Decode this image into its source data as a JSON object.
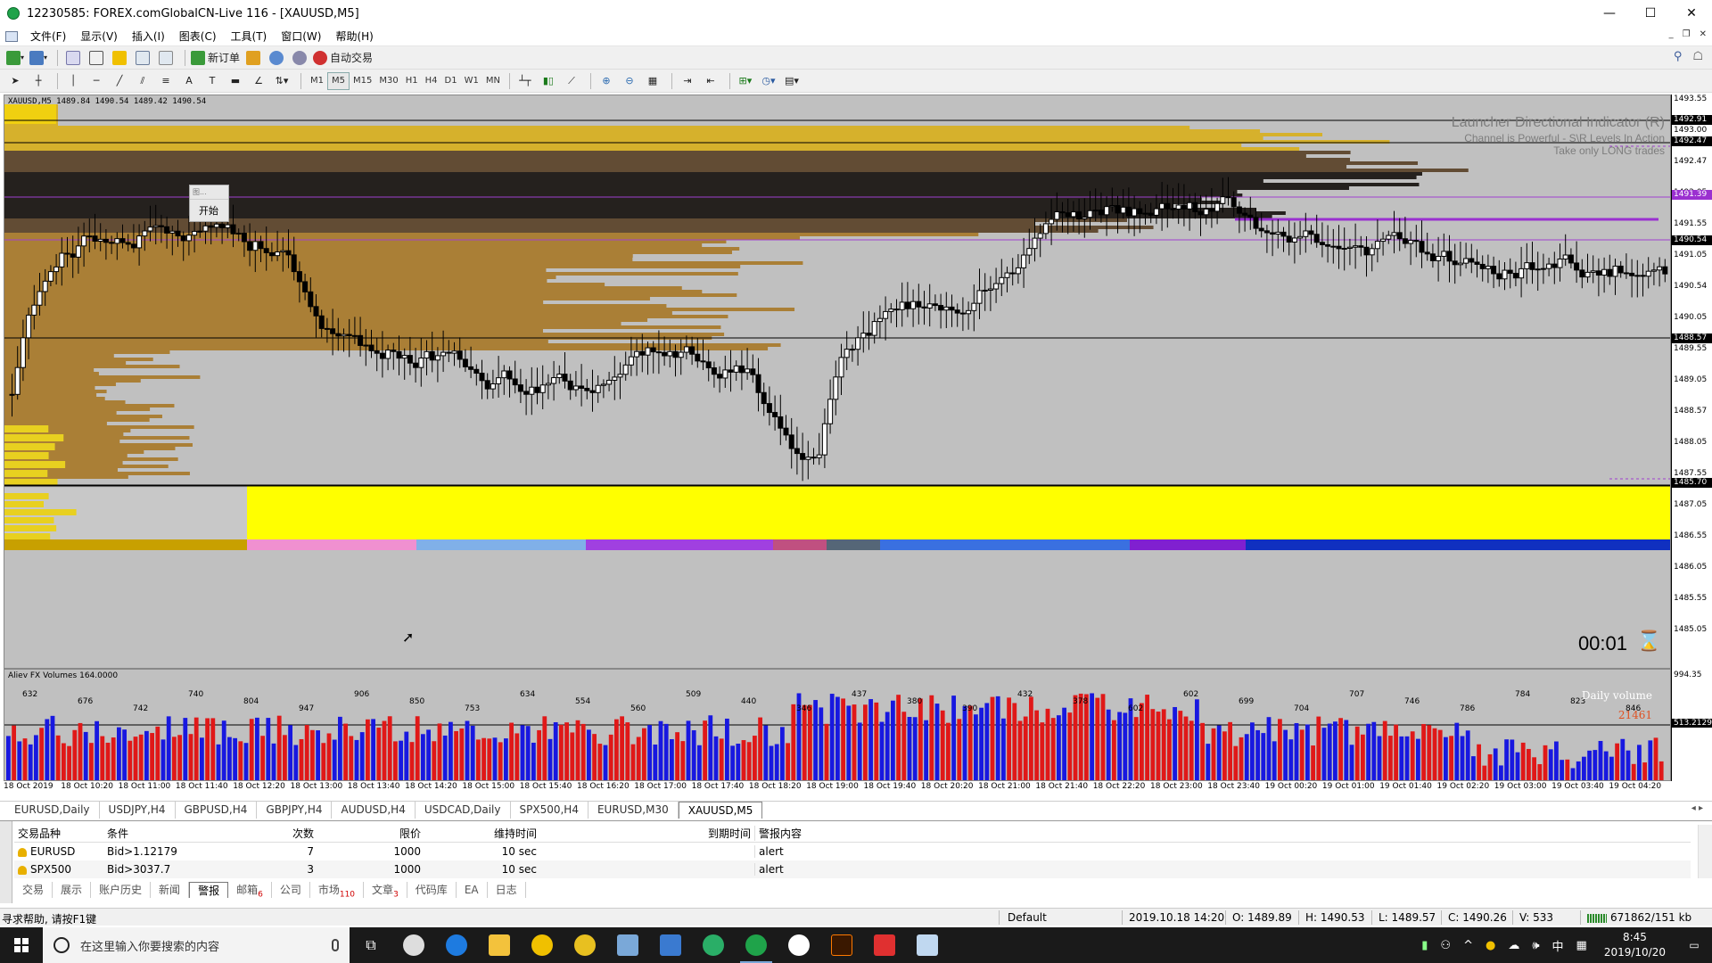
{
  "window": {
    "title": "12230585: FOREX.comGlobalCN-Live 116 - [XAUUSD,M5]",
    "minimize": "—",
    "maximize": "☐",
    "close": "✕"
  },
  "menu": {
    "items": [
      "文件(F)",
      "显示(V)",
      "插入(I)",
      "图表(C)",
      "工具(T)",
      "窗口(W)",
      "帮助(H)"
    ],
    "mdi_controls": [
      "_",
      "❐",
      "✕"
    ]
  },
  "toolbar1": {
    "new_order": "新订单",
    "auto_trading": "自动交易"
  },
  "toolbar2": {
    "timeframes": [
      "M1",
      "M5",
      "M15",
      "M30",
      "H1",
      "H4",
      "D1",
      "W1",
      "MN"
    ],
    "active_timeframe": "M5"
  },
  "chart": {
    "header": "XAUUSD,M5  1489.84 1490.54 1489.42 1490.54",
    "indicator_title": "Launcher Directional Indicator (R)",
    "indicator_line2": "Channel is Powerful - S\\R Levels In Action",
    "indicator_line3": "Take only LONG trades",
    "popup_top": "图...",
    "popup_start": "开始",
    "countdown": "00:01",
    "price_ticks": [
      "1493.55",
      "1493.00",
      "1492.47",
      "1492.05",
      "1491.55",
      "1491.05",
      "1490.54",
      "1490.05",
      "1489.55",
      "1489.05",
      "1488.57",
      "1488.05",
      "1487.55",
      "1487.05",
      "1486.55",
      "1486.05",
      "1485.55",
      "1485.05"
    ],
    "price_highlights": [
      {
        "label": "1492.91",
        "color": "#000000"
      },
      {
        "label": "1492.47",
        "color": "#000000"
      },
      {
        "label": "1491.39",
        "color": "#9b30d0"
      },
      {
        "label": "1490.54",
        "color": "#000000"
      },
      {
        "label": "1488.57",
        "color": "#000000"
      },
      {
        "label": "1485.70",
        "color": "#000000"
      }
    ]
  },
  "volume": {
    "title": "Aliev FX Volumes 164.0000",
    "daily_label": "Daily volume",
    "daily_value": "21461",
    "axis_top": "994.35",
    "axis_mid": "513.2129",
    "labels": [
      "632",
      "676",
      "742",
      "740",
      "804",
      "947",
      "906",
      "850",
      "753",
      "634",
      "554",
      "560",
      "509",
      "440",
      "346",
      "437",
      "380",
      "390",
      "432",
      "378",
      "602",
      "602",
      "699",
      "704",
      "707",
      "746",
      "786",
      "784",
      "823",
      "846"
    ]
  },
  "time_axis": [
    "18 Oct 2019",
    "18 Oct 10:20",
    "18 Oct 11:00",
    "18 Oct 11:40",
    "18 Oct 12:20",
    "18 Oct 13:00",
    "18 Oct 13:40",
    "18 Oct 14:20",
    "18 Oct 15:00",
    "18 Oct 15:40",
    "18 Oct 16:20",
    "18 Oct 17:00",
    "18 Oct 17:40",
    "18 Oct 18:20",
    "18 Oct 19:00",
    "18 Oct 19:40",
    "18 Oct 20:20",
    "18 Oct 21:00",
    "18 Oct 21:40",
    "18 Oct 22:20",
    "18 Oct 23:00",
    "18 Oct 23:40",
    "19 Oct 00:20",
    "19 Oct 01:00",
    "19 Oct 01:40",
    "19 Oct 02:20",
    "19 Oct 03:00",
    "19 Oct 03:40",
    "19 Oct 04:20"
  ],
  "chart_tabs": [
    "EURUSD,Daily",
    "USDJPY,H4",
    "GBPUSD,H4",
    "GBPJPY,H4",
    "AUDUSD,H4",
    "USDCAD,Daily",
    "SPX500,H4",
    "EURUSD,M30",
    "XAUUSD,M5"
  ],
  "active_chart_tab": "XAUUSD,M5",
  "terminal": {
    "headers": [
      "交易品种",
      "条件",
      "次数",
      "限价",
      "维持时间",
      "到期时间",
      "警报内容"
    ],
    "rows": [
      [
        "EURUSD",
        "Bid>1.12179",
        "7",
        "1000",
        "10 sec",
        "",
        "alert"
      ],
      [
        "SPX500",
        "Bid>3037.7",
        "3",
        "1000",
        "10 sec",
        "",
        "alert"
      ]
    ],
    "tabs": [
      {
        "label": "交易",
        "badge": ""
      },
      {
        "label": "展示",
        "badge": ""
      },
      {
        "label": "账户历史",
        "badge": ""
      },
      {
        "label": "新闻",
        "badge": ""
      },
      {
        "label": "警报",
        "badge": ""
      },
      {
        "label": "邮箱",
        "badge": "6"
      },
      {
        "label": "公司",
        "badge": ""
      },
      {
        "label": "市场",
        "badge": "110"
      },
      {
        "label": "文章",
        "badge": "3"
      },
      {
        "label": "代码库",
        "badge": ""
      },
      {
        "label": "EA",
        "badge": ""
      },
      {
        "label": "日志",
        "badge": ""
      }
    ],
    "active_tab": "警报"
  },
  "status": {
    "help": "寻求帮助, 请按F1键",
    "profile": "Default",
    "datetime": "2019.10.18 14:20",
    "open": "O: 1489.89",
    "high": "H: 1490.53",
    "low": "L: 1489.57",
    "close": "C: 1490.26",
    "volume": "V: 533",
    "traffic": "671862/151 kb"
  },
  "taskbar": {
    "search_placeholder": "在这里输入你要搜索的内容",
    "ime": "中",
    "time": "8:45",
    "date": "2019/10/20"
  }
}
